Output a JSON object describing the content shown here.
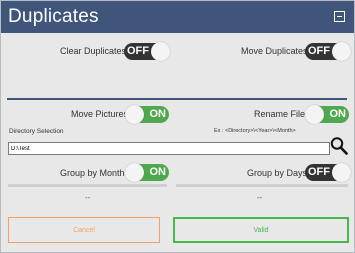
{
  "window": {
    "title": "Duplicates"
  },
  "options": {
    "clear_duplicates": {
      "label": "Clear Duplicates",
      "state": "OFF"
    },
    "move_duplicates": {
      "label": "Move Duplicates",
      "state": "OFF"
    },
    "move_pictures": {
      "label": "Move Pictures",
      "state": "ON"
    },
    "rename_files": {
      "label": "Rename Files",
      "state": "ON"
    },
    "group_by_month": {
      "label": "Group by Month",
      "state": "ON"
    },
    "group_by_days": {
      "label": "Group by Days",
      "state": "OFF"
    }
  },
  "directory": {
    "label": "Directory Selection",
    "example": "Ex : <Directory>\\<Year>\\<Month>",
    "value": "D:\\Test"
  },
  "status": {
    "left": "--",
    "right": "--"
  },
  "buttons": {
    "cancel": "Cancel",
    "valid": "Valid"
  },
  "colors": {
    "titlebar": "#3f5579",
    "on": "#4fa84f",
    "off": "#333333",
    "cancel": "#f0a06a",
    "valid": "#46b84c"
  }
}
